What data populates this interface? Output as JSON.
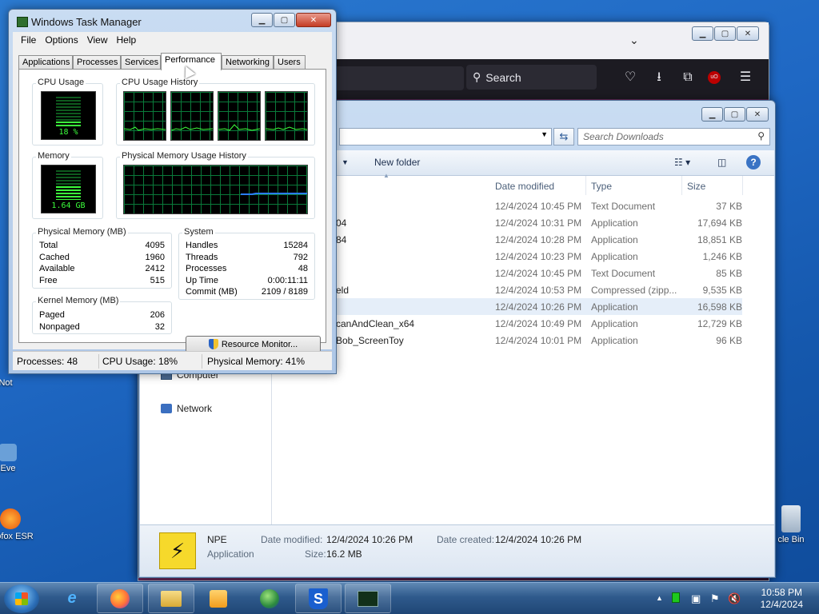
{
  "desktop": {
    "icons": [
      {
        "label": "Not"
      },
      {
        "label": "Eve"
      },
      {
        "label": "rSofox ESR"
      },
      {
        "label": "cle Bin"
      }
    ]
  },
  "firefox": {
    "search_label": "Search"
  },
  "explorer": {
    "search_placeholder": "Search Downloads",
    "toolbar": {
      "new_folder": "New folder"
    },
    "columns": {
      "date": "Date modified",
      "type": "Type",
      "size": "Size"
    },
    "files": [
      {
        "name": "",
        "date": "12/4/2024 10:45 PM",
        "type": "Text Document",
        "size": "37 KB",
        "selected": false
      },
      {
        "name": "04",
        "date": "12/4/2024 10:31 PM",
        "type": "Application",
        "size": "17,694 KB",
        "selected": false
      },
      {
        "name": "84",
        "date": "12/4/2024 10:28 PM",
        "type": "Application",
        "size": "18,851 KB",
        "selected": false
      },
      {
        "name": "",
        "date": "12/4/2024 10:23 PM",
        "type": "Application",
        "size": "1,246 KB",
        "selected": false
      },
      {
        "name": "",
        "date": "12/4/2024 10:45 PM",
        "type": "Text Document",
        "size": "85 KB",
        "selected": false
      },
      {
        "name": "eld",
        "date": "12/4/2024 10:53 PM",
        "type": "Compressed (zipp...",
        "size": "9,535 KB",
        "selected": false
      },
      {
        "name": "",
        "date": "12/4/2024 10:26 PM",
        "type": "Application",
        "size": "16,598 KB",
        "selected": true
      },
      {
        "name": "canAndClean_x64",
        "date": "12/4/2024 10:49 PM",
        "type": "Application",
        "size": "12,729 KB",
        "selected": false
      },
      {
        "name": "Bob_ScreenToy",
        "date": "12/4/2024 10:01 PM",
        "type": "Application",
        "size": "96 KB",
        "selected": false
      }
    ],
    "nav": {
      "computer": "Computer",
      "network": "Network"
    },
    "details": {
      "name": "NPE",
      "kind": "Application",
      "modified_label": "Date modified:",
      "modified_value": "12/4/2024 10:26 PM",
      "created_label": "Date created:",
      "created_value": "12/4/2024 10:26 PM",
      "size_label": "Size:",
      "size_value": "16.2 MB"
    }
  },
  "taskmgr": {
    "title": "Windows Task Manager",
    "menu": [
      "File",
      "Options",
      "View",
      "Help"
    ],
    "tabs": [
      "Applications",
      "Processes",
      "Services",
      "Performance",
      "Networking",
      "Users"
    ],
    "active_tab": "Performance",
    "cpu": {
      "title": "CPU Usage",
      "value": "18 %",
      "history_title": "CPU Usage History"
    },
    "memory": {
      "title": "Memory",
      "value": "1.64 GB",
      "history_title": "Physical Memory Usage History"
    },
    "physical_memory": {
      "title": "Physical Memory (MB)",
      "rows": [
        {
          "k": "Total",
          "v": "4095"
        },
        {
          "k": "Cached",
          "v": "1960"
        },
        {
          "k": "Available",
          "v": "2412"
        },
        {
          "k": "Free",
          "v": "515"
        }
      ]
    },
    "kernel_memory": {
      "title": "Kernel Memory (MB)",
      "rows": [
        {
          "k": "Paged",
          "v": "206"
        },
        {
          "k": "Nonpaged",
          "v": "32"
        }
      ]
    },
    "system": {
      "title": "System",
      "rows": [
        {
          "k": "Handles",
          "v": "15284"
        },
        {
          "k": "Threads",
          "v": "792"
        },
        {
          "k": "Processes",
          "v": "48"
        },
        {
          "k": "Up Time",
          "v": "0:00:11:11"
        },
        {
          "k": "Commit (MB)",
          "v": "2109 / 8189"
        }
      ]
    },
    "resource_monitor": "Resource Monitor...",
    "status": {
      "processes": "Processes: 48",
      "cpu": "CPU Usage: 18%",
      "memory": "Physical Memory: 41%"
    }
  },
  "taskbar": {
    "time": "10:58 PM",
    "date": "12/4/2024"
  }
}
